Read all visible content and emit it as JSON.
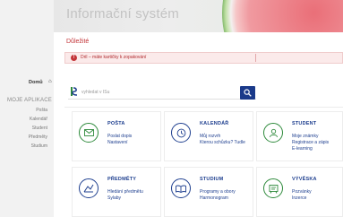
{
  "header": {
    "title": "Informační systém"
  },
  "notice": {
    "heading": "Důležité",
    "alert_text": "Dril – máte kartičky k zopakování"
  },
  "sidebar": {
    "home": "Domů",
    "apps_heading": "MOJE APLIKACE",
    "items": [
      "Pošta",
      "Kalendář",
      "Student",
      "Předměty",
      "Studium"
    ]
  },
  "search": {
    "placeholder": "vyhledat v ISu"
  },
  "tiles": [
    {
      "title": "POŠTA",
      "links": [
        "Poslat dopis",
        "Nastavení"
      ],
      "color": "#2e8a3b",
      "icon": "envelope-icon"
    },
    {
      "title": "KALENDÁŘ",
      "links": [
        "Můj rozvrh",
        "Kterou schůzku? Tudle"
      ],
      "color": "#1e3f8f",
      "icon": "clock-icon"
    },
    {
      "title": "STUDENT",
      "links": [
        "Moje známky",
        "Registrace a zápis",
        "E-learning"
      ],
      "color": "#2e8a3b",
      "icon": "student-icon"
    },
    {
      "title": "PŘEDMĚTY",
      "links": [
        "Hledání předmětu",
        "Sylaby"
      ],
      "color": "#1e3f8f",
      "icon": "subjects-icon"
    },
    {
      "title": "STUDIUM",
      "links": [
        "Programy a obory",
        "Harmonogram"
      ],
      "color": "#1e3f8f",
      "icon": "book-icon"
    },
    {
      "title": "VÝVĚSKA",
      "links": [
        "Pozvánky",
        "Inzerce"
      ],
      "color": "#2e8a3b",
      "icon": "noticeboard-icon"
    }
  ]
}
